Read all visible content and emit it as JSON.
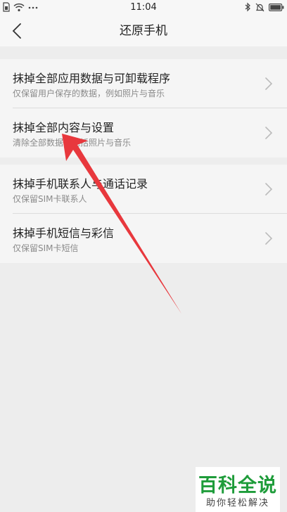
{
  "status_bar": {
    "time": "11:04",
    "icons": [
      "sim-icon",
      "wifi-icon",
      "more-icon",
      "bluetooth-icon",
      "mute-icon",
      "battery-icon"
    ]
  },
  "header": {
    "back_icon": "chevron-left-icon",
    "title": "还原手机"
  },
  "groups": [
    {
      "items": [
        {
          "title": "抹掉全部应用数据与可卸载程序",
          "subtitle": "仅保留用户保存的数据，例如照片与音乐"
        },
        {
          "title": "抹掉全部内容与设置",
          "subtitle": "清除全部数据，包括照片与音乐"
        }
      ]
    },
    {
      "items": [
        {
          "title": "抹掉手机联系人与通话记录",
          "subtitle": "仅保留SIM卡联系人"
        },
        {
          "title": "抹掉手机短信与彩信",
          "subtitle": "仅保留SIM卡短信"
        }
      ]
    }
  ],
  "annotation": {
    "color": "#e8383d"
  },
  "watermark": {
    "main": "百科全说",
    "sub": "助你轻松解决",
    "color": "#1e9c3a"
  }
}
